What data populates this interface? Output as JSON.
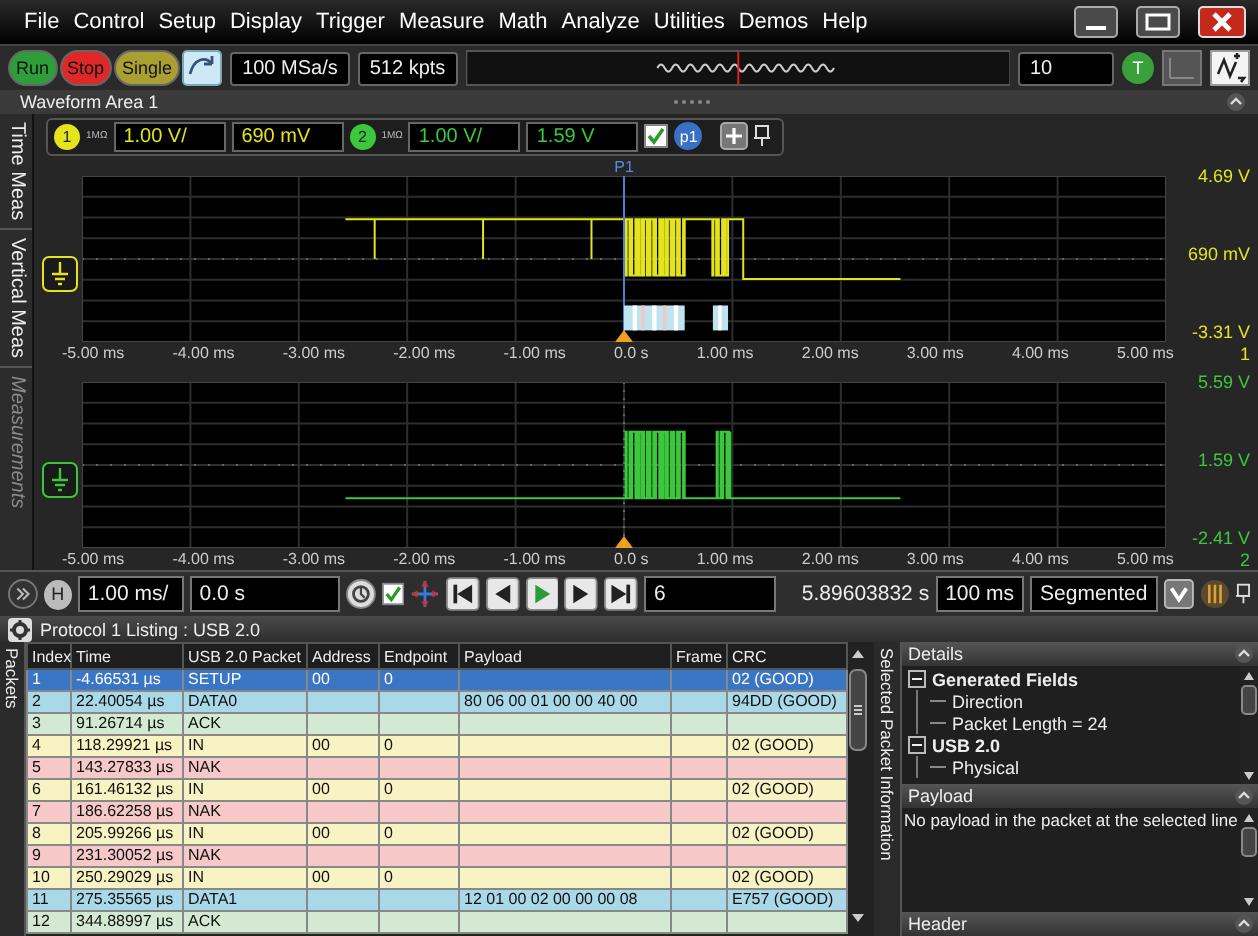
{
  "menu": [
    "File",
    "Control",
    "Setup",
    "Display",
    "Trigger",
    "Measure",
    "Math",
    "Analyze",
    "Utilities",
    "Demos",
    "Help"
  ],
  "toolbar": {
    "buttons": [
      {
        "label": "Run",
        "color": "#2e9e3a"
      },
      {
        "label": "Stop",
        "color": "#e02828"
      },
      {
        "label": "Single",
        "color": "#aaa032"
      }
    ],
    "sample_rate": "100 MSa/s",
    "memory_depth": "512 kpts",
    "count": "10",
    "trigger_badge": "T"
  },
  "waveform_area": {
    "title": "Waveform Area 1",
    "side_tabs": [
      {
        "label": "Time Meas",
        "disabled": false
      },
      {
        "label": "Vertical Meas",
        "disabled": false
      },
      {
        "label": "Measurements",
        "disabled": true
      }
    ],
    "channels": [
      {
        "number": "1",
        "impedance": "1MΩ",
        "scale": "1.00 V/",
        "offset": "690 mV",
        "color": "#e4e41c",
        "y_labels": [
          "4.69 V",
          "690 mV",
          "-3.31 V"
        ],
        "x_labels": [
          "-5.00 ms",
          "-4.00 ms",
          "-3.00 ms",
          "-2.00 ms",
          "-1.00 ms",
          "0.0 s",
          "1.00 ms",
          "2.00 ms",
          "3.00 ms",
          "4.00 ms",
          "5.00 ms"
        ],
        "plot_index": "1",
        "marker": "P1"
      },
      {
        "number": "2",
        "impedance": "1MΩ",
        "scale": "1.00 V/",
        "offset": "1.59 V",
        "color": "#3cc83c",
        "y_labels": [
          "5.59 V",
          "1.59 V",
          "-2.41 V"
        ],
        "x_labels": [
          "-5.00 ms",
          "-4.00 ms",
          "-3.00 ms",
          "-2.00 ms",
          "-1.00 ms",
          "0.0 s",
          "1.00 ms",
          "2.00 ms",
          "3.00 ms",
          "4.00 ms",
          "5.00 ms"
        ],
        "plot_index": "2"
      }
    ],
    "markers": {
      "checked": true,
      "badge": "p1"
    }
  },
  "horizontal": {
    "badge": "H",
    "scale": "1.00 ms/",
    "position": "0.0 s",
    "checked": true,
    "segment": "6",
    "time": "5.89603832 s",
    "interval": "100 ms",
    "mode": "Segmented"
  },
  "protocol": {
    "title": "Protocol 1 Listing : USB 2.0",
    "side_tab": "Packets",
    "columns": [
      "Index",
      "Time",
      "USB 2.0 Packet",
      "Address",
      "Endpoint",
      "Payload",
      "Frame",
      "CRC"
    ],
    "rows": [
      {
        "index": "1",
        "time": "-4.66531 µs",
        "packet": "SETUP",
        "address": "00",
        "endpoint": "0",
        "crc": "02 (GOOD)",
        "selected": true
      },
      {
        "index": "2",
        "time": "22.40054 µs",
        "packet": "DATA0",
        "payload": "80 06 00 01 00 00 40 00",
        "crc": "94DD (GOOD)",
        "color": "#a9d9e8",
        "selected": false
      },
      {
        "index": "3",
        "time": "91.26714 µs",
        "packet": "ACK",
        "color": "#d3e9d1",
        "selected": false
      },
      {
        "index": "4",
        "time": "118.29921 µs",
        "packet": "IN",
        "address": "00",
        "endpoint": "0",
        "crc": "02 (GOOD)",
        "color": "#f7f3c2",
        "selected": false
      },
      {
        "index": "5",
        "time": "143.27833 µs",
        "packet": "NAK",
        "color": "#f6c8c8",
        "selected": false
      },
      {
        "index": "6",
        "time": "161.46132 µs",
        "packet": "IN",
        "address": "00",
        "endpoint": "0",
        "crc": "02 (GOOD)",
        "color": "#f7f3c2",
        "selected": false
      },
      {
        "index": "7",
        "time": "186.62258 µs",
        "packet": "NAK",
        "color": "#f6c8c8",
        "selected": false
      },
      {
        "index": "8",
        "time": "205.99266 µs",
        "packet": "IN",
        "address": "00",
        "endpoint": "0",
        "crc": "02 (GOOD)",
        "color": "#f7f3c2",
        "selected": false
      },
      {
        "index": "9",
        "time": "231.30052 µs",
        "packet": "NAK",
        "color": "#f6c8c8",
        "selected": false
      },
      {
        "index": "10",
        "time": "250.29029 µs",
        "packet": "IN",
        "address": "00",
        "endpoint": "0",
        "crc": "02 (GOOD)",
        "color": "#f7f3c2",
        "selected": false
      },
      {
        "index": "11",
        "time": "275.35565 µs",
        "packet": "DATA1",
        "payload": "12 01 00 02 00 00 00 08",
        "crc": "E757 (GOOD)",
        "color": "#a9d9e8",
        "selected": false
      },
      {
        "index": "12",
        "time": "344.88997 µs",
        "packet": "ACK",
        "color": "#d3e9d1",
        "selected": false
      }
    ]
  },
  "packet_info": {
    "title": "Selected Packet Information",
    "details": {
      "title": "Details",
      "tree": [
        {
          "label": "Generated Fields",
          "expanded": true,
          "children": [
            {
              "label": "Direction"
            },
            {
              "label": "Packet Length = 24"
            }
          ]
        },
        {
          "label": "USB 2.0",
          "expanded": true,
          "children": [
            {
              "label": "Physical"
            }
          ]
        }
      ]
    },
    "payload": {
      "title": "Payload",
      "text": "No payload in the packet at the selected line"
    },
    "header": {
      "title": "Header"
    }
  }
}
